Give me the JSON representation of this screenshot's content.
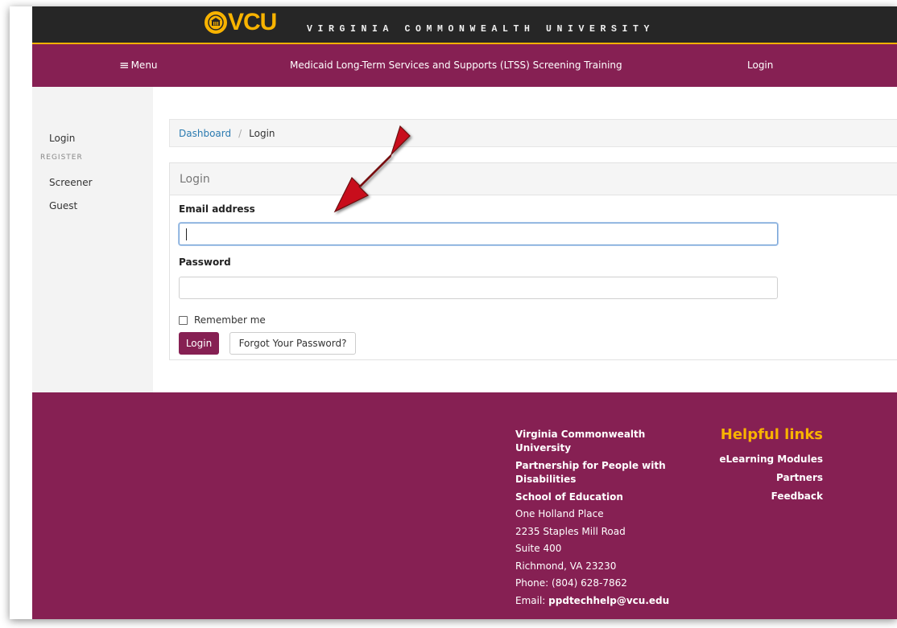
{
  "header": {
    "logo_text": "VCU",
    "university_name": "VIRGINIA COMMONWEALTH UNIVERSITY"
  },
  "nav": {
    "menu_label": "Menu",
    "title": "Medicaid Long-Term Services and Supports (LTSS) Screening Training",
    "login_label": "Login"
  },
  "sidebar": {
    "login": "Login",
    "register_heading": "REGISTER",
    "items": [
      "Screener",
      "Guest"
    ]
  },
  "breadcrumb": {
    "parent": "Dashboard",
    "separator": "/",
    "current": "Login"
  },
  "login_form": {
    "heading": "Login",
    "email_label": "Email address",
    "email_value": "",
    "password_label": "Password",
    "password_value": "",
    "remember_label": "Remember me",
    "remember_checked": false,
    "submit_label": "Login",
    "forgot_label": "Forgot Your Password?"
  },
  "annotation": {
    "arrow_color": "#c8101e"
  },
  "footer": {
    "org_lines": [
      "Virginia Commonwealth University",
      "Partnership for People with Disabilities",
      "School of Education"
    ],
    "address_lines": [
      "One Holland Place",
      "2235 Staples Mill Road",
      "Suite 400",
      "Richmond, VA 23230",
      "Phone: (804) 628-7862"
    ],
    "email_label": "Email:",
    "email_value": "ppdtechhelp@vcu.edu",
    "helpful_links_title": "Helpful links",
    "links": [
      "eLearning Modules",
      "Partners",
      "Feedback"
    ]
  },
  "colors": {
    "brand_maroon": "#862053",
    "brand_gold": "#f8b300",
    "topbar_black": "#262626"
  }
}
